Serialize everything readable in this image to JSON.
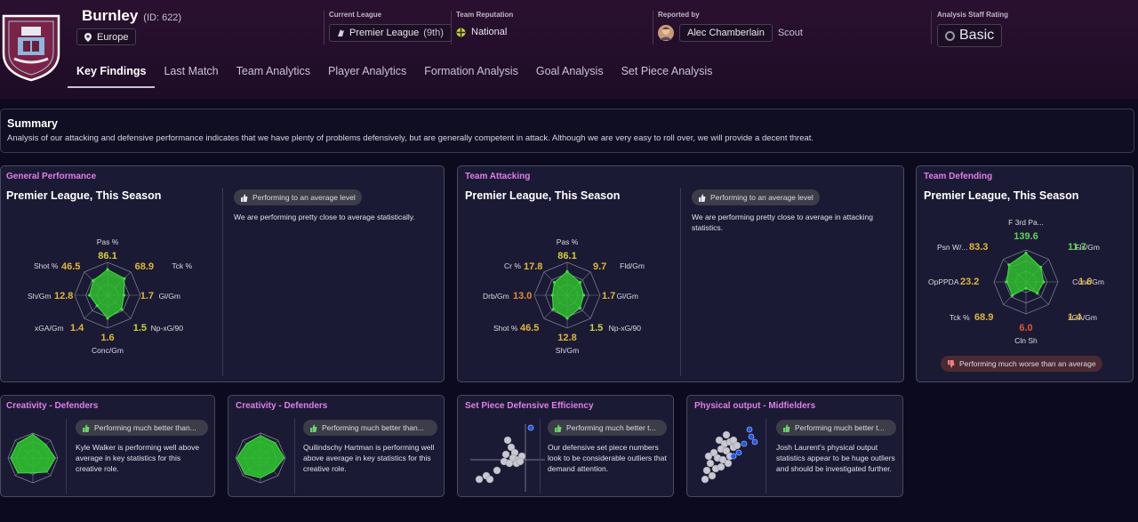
{
  "header": {
    "club_name": "Burnley",
    "club_id": "(ID: 622)",
    "region": "Europe",
    "current_league_label": "Current League",
    "current_league_value": "Premier League",
    "current_league_pos": "(9th)",
    "team_reputation_label": "Team Reputation",
    "team_reputation_value": "National",
    "reported_by_label": "Reported by",
    "reporter_name": "Alec Chamberlain",
    "reporter_role": "Scout",
    "staff_rating_label": "Analysis Staff Rating",
    "staff_rating_value": "Basic"
  },
  "tabs": [
    "Key Findings",
    "Last Match",
    "Team Analytics",
    "Player Analytics",
    "Formation Analysis",
    "Goal Analysis",
    "Set Piece Analysis"
  ],
  "summary": {
    "title": "Summary",
    "text": "Analysis of our attacking and defensive performance indicates that we have plenty of problems defensively, but are generally competent in attack. Although we are very easy to roll over, we will provide a decent threat."
  },
  "general": {
    "title": "General Performance",
    "subtitle": "Premier League, This Season",
    "badge": "Performing to an average level",
    "desc": "We are performing pretty close to average statistically.",
    "metrics": [
      {
        "label": "Pas %",
        "value": "86.1",
        "color": "#d9cc3c"
      },
      {
        "label": "Tck %",
        "value": "68.9",
        "color": "#e0b63a"
      },
      {
        "label": "Gl/Gm",
        "value": "1.7",
        "color": "#e0b63a"
      },
      {
        "label": "Np-xG/90",
        "value": "1.5",
        "color": "#c9d33c"
      },
      {
        "label": "Conc/Gm",
        "value": "1.6",
        "color": "#e0b63a"
      },
      {
        "label": "xGA/Gm",
        "value": "1.4",
        "color": "#e0b63a"
      },
      {
        "label": "Sh/Gm",
        "value": "12.8",
        "color": "#e0b63a"
      },
      {
        "label": "Shot %",
        "value": "46.5",
        "color": "#e0b63a"
      }
    ]
  },
  "attacking": {
    "title": "Team Attacking",
    "subtitle": "Premier League, This Season",
    "badge": "Performing to an average level",
    "desc": "We are performing pretty close to average in attacking statistics.",
    "metrics": [
      {
        "label": "Pas %",
        "value": "86.1",
        "color": "#d9cc3c"
      },
      {
        "label": "Fld/Gm",
        "value": "9.7",
        "color": "#e0b63a"
      },
      {
        "label": "Gl/Gm",
        "value": "1.7",
        "color": "#e0b63a"
      },
      {
        "label": "Np-xG/90",
        "value": "1.5",
        "color": "#c9d33c"
      },
      {
        "label": "Sh/Gm",
        "value": "12.8",
        "color": "#e0b63a"
      },
      {
        "label": "Shot %",
        "value": "46.5",
        "color": "#e0b63a"
      },
      {
        "label": "Drb/Gm",
        "value": "13.0",
        "color": "#e08a3a"
      },
      {
        "label": "Cr %",
        "value": "17.8",
        "color": "#e0b63a"
      }
    ]
  },
  "defending": {
    "title": "Team Defending",
    "subtitle": "Premier League, This Season",
    "badge": "Performing much worse than an average",
    "metrics": [
      {
        "label": "F 3rd Pa...",
        "value": "139.6",
        "color": "#5ed25a"
      },
      {
        "label": "Fls/Gm",
        "value": "11.7",
        "color": "#5ed25a"
      },
      {
        "label": "Conc/Gm",
        "value": "1.6",
        "color": "#e0b63a"
      },
      {
        "label": "xGA/Gm",
        "value": "1.4",
        "color": "#e0b63a"
      },
      {
        "label": "Cln Sh",
        "value": "6.0",
        "color": "#e0553a"
      },
      {
        "label": "Tck %",
        "value": "68.9",
        "color": "#e0b63a"
      },
      {
        "label": "OpPPDA",
        "value": "23.2",
        "color": "#e0b63a"
      },
      {
        "label": "Psn W/...",
        "value": "83.3",
        "color": "#e0b63a"
      }
    ]
  },
  "creativity1": {
    "title": "Creativity - Defenders",
    "badge": "Performing much better than...",
    "desc": "Kyle Walker is performing well above average in key statistics for this creative role."
  },
  "creativity2": {
    "title": "Creativity - Defenders",
    "badge": "Performing much better than...",
    "desc": "Quilindschy Hartman is performing well above average in key statistics for this creative role."
  },
  "setpiece": {
    "title": "Set Piece Defensive Efficiency",
    "badge": "Performing much better t...",
    "desc": "Our defensive set piece numbers look to be considerable outliers that demand attention."
  },
  "physical": {
    "title": "Physical output - Midfielders",
    "badge": "Performing much better t...",
    "desc": "Josh Laurent's physical output statistics appear to be huge outliers and should be investigated further."
  }
}
